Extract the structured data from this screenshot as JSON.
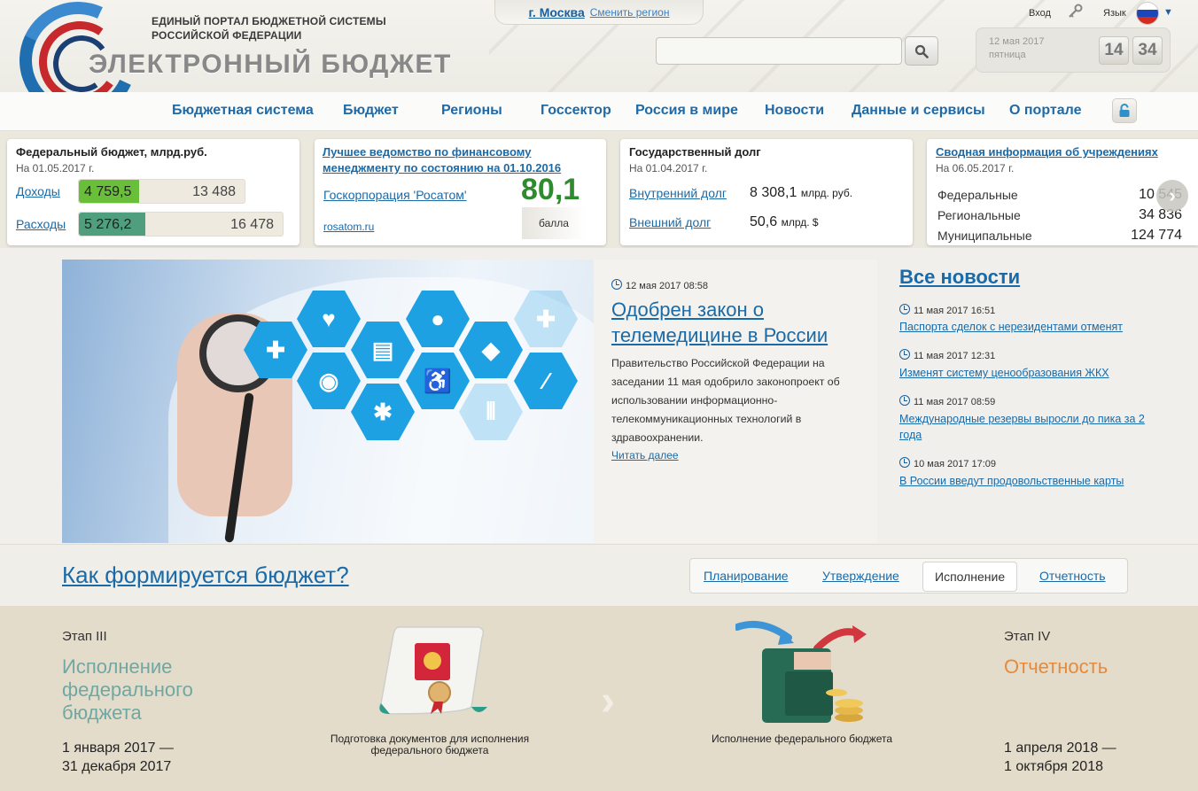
{
  "header": {
    "org_line1": "ЕДИНЫЙ ПОРТАЛ БЮДЖЕТНОЙ СИСТЕМЫ",
    "org_line2": "РОССИЙСКОЙ ФЕДЕРАЦИИ",
    "brand": "ЭЛЕКТРОННЫЙ БЮДЖЕТ",
    "region_city": "г. Москва",
    "region_change": "Сменить регион",
    "search_placeholder": "",
    "login_label": "Вход",
    "lang_label": "Язык",
    "lang_arrow": "▼",
    "date_line1": "12 мая 2017",
    "date_line2": "пятница",
    "clock_hours": "14",
    "clock_minutes": "34"
  },
  "nav": {
    "items": [
      "Бюджетная система",
      "Бюджет",
      "Регионы",
      "Госсектор",
      "Россия в мире",
      "Новости",
      "Данные и сервисы",
      "О портале"
    ]
  },
  "cards": {
    "federal": {
      "title": "Федеральный бюджет, млрд.руб.",
      "date": "На 01.05.2017 г.",
      "income_label": "Доходы",
      "income_value": "4 759,5",
      "income_total": "13 488",
      "expense_label": "Расходы",
      "expense_value": "5 276,2",
      "expense_total": "16 478",
      "income_color": "#6abf3a",
      "expense_color": "#4f9e7e"
    },
    "ministry": {
      "title1": "Лучшее ведомство по финансовому",
      "title2": "менеджменту по состоянию на 01.10.2016",
      "org": "Госкорпорация 'Росатом'",
      "score": "80,1",
      "score_unit": "балла",
      "site": "rosatom.ru"
    },
    "debt": {
      "title": "Государственный долг",
      "date": "На 01.04.2017 г.",
      "internal_label": "Внутренний долг",
      "internal_value": "8 308,1",
      "internal_unit": "млрд. руб.",
      "external_label": "Внешний долг",
      "external_value": "50,6",
      "external_unit": "млрд. $"
    },
    "institutions": {
      "title": "Сводная информация об учреждениях",
      "date": "На 06.05.2017 г.",
      "rows": [
        {
          "label": "Федеральные",
          "value": "10 545"
        },
        {
          "label": "Региональные",
          "value": "34 836"
        },
        {
          "label": "Муниципальные",
          "value": "124 774"
        }
      ]
    }
  },
  "feature": {
    "date": "12 мая 2017 08:58",
    "headline": "Одобрен закон о телемедицине в России",
    "body": "Правительство Российской Федерации на заседании 11 мая одобрило законопроект об использовании информационно-телекоммуникационных технологий в здравоохранении.",
    "more": "Читать далее"
  },
  "news": {
    "all_label": "Все новости",
    "items": [
      {
        "date": "11 мая 2017 16:51",
        "title": "Паспорта сделок с нерезидентами отменят"
      },
      {
        "date": "11 мая 2017 12:31",
        "title": "Изменят систему ценообразования ЖКХ"
      },
      {
        "date": "11 мая 2017 08:59",
        "title": "Международные резервы выросли до пика за 2 года"
      },
      {
        "date": "10 мая 2017 17:09",
        "title": "В России введут продовольственные карты"
      }
    ]
  },
  "process": {
    "title": "Как формируется бюджет?",
    "tabs": [
      "Планирование",
      "Утверждение",
      "Исполнение",
      "Отчетность"
    ],
    "active_tab": "Исполнение",
    "stage3_label": "Этап III",
    "stage3_name": "Исполнение федерального бюджета",
    "stage3_dates1": "1 января 2017 —",
    "stage3_dates2": "31 декабря 2017",
    "step1_caption": "Подготовка документов для исполнения федерального бюджета",
    "step2_caption": "Исполнение федерального бюджета",
    "stage4_label": "Этап IV",
    "stage4_name": "Отчетность",
    "stage4_dates1": "1 апреля 2018 —",
    "stage4_dates2": "1 октября 2018",
    "stage3_color": "#6fa8a2",
    "stage4_color": "#e68a3a"
  }
}
